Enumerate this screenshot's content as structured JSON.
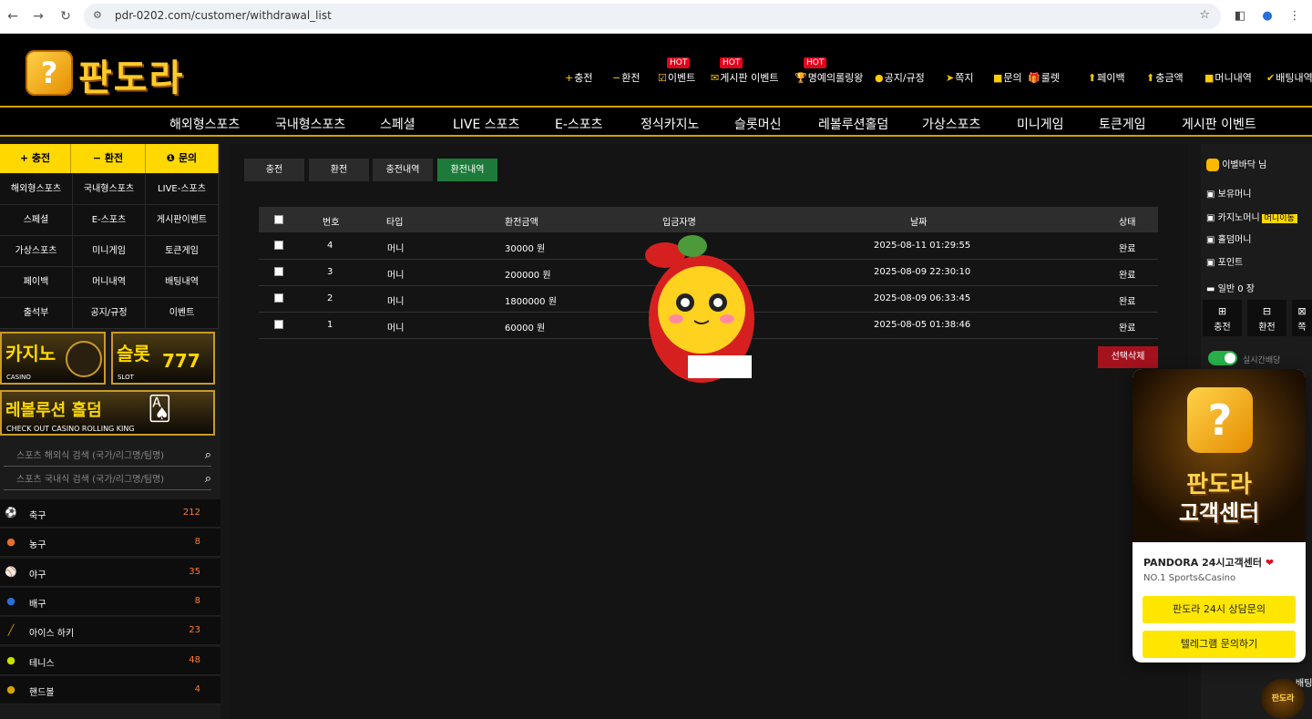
{
  "browser": {
    "url": "pdr-0202.com/customer/withdrawal_list"
  },
  "logo": {
    "text": "판도라",
    "mark": "?"
  },
  "top_links": [
    {
      "label": "충전",
      "icon": "+"
    },
    {
      "label": "환전",
      "icon": "−"
    },
    {
      "label": "이벤트",
      "icon": "☑",
      "hot": "HOT"
    },
    {
      "label": "게시판 이벤트",
      "icon": "✉",
      "hot": "HOT"
    },
    {
      "label": "명예의롤링왕",
      "icon": "🏆",
      "hot": "HOT"
    },
    {
      "label": "공지/규정",
      "icon": "●"
    },
    {
      "label": "쪽지",
      "icon": "➤"
    },
    {
      "label": "문의",
      "icon": "■"
    },
    {
      "label": "룰렛",
      "icon": "🎁"
    },
    {
      "label": "페이백",
      "icon": "⬆"
    },
    {
      "label": "충금액",
      "icon": "⬆"
    },
    {
      "label": "머니내역",
      "icon": "■"
    },
    {
      "label": "배팅내역",
      "icon": "✔"
    }
  ],
  "main_nav": [
    "해외형스포츠",
    "국내형스포츠",
    "스페셜",
    "LIVE 스포츠",
    "E-스포츠",
    "정식카지노",
    "슬롯머신",
    "레볼루션홀덤",
    "가상스포츠",
    "미니게임",
    "토큰게임",
    "게시판 이벤트"
  ],
  "sidebar": {
    "top_buttons": [
      {
        "label": "+ 충전"
      },
      {
        "label": "− 환전"
      },
      {
        "label": "❶ 문의"
      }
    ],
    "grid": [
      "해외형스포츠",
      "국내형스포츠",
      "LIVE-스포츠",
      "스페셜",
      "E-스포츠",
      "게시판이벤트",
      "가상스포츠",
      "미니게임",
      "토큰게임",
      "페이백",
      "머니내역",
      "배팅내역",
      "출석부",
      "공지/규정",
      "이벤트"
    ],
    "banners": {
      "casino_big": "카지노",
      "casino_small": "CASINO",
      "slot_big": "슬롯",
      "slot_small": "SLOT",
      "holdem_big": "레볼루션 홀덤",
      "holdem_small": "CHECK OUT CASINO ROLLING KING"
    },
    "search_overseas_placeholder": "스포츠 해외식 검색 (국가/리그명/팀명)",
    "search_domestic_placeholder": "스포츠 국내식 검색 (국가/리그명/팀명)",
    "sports": [
      {
        "name": "축구",
        "count": "212",
        "icon": "⚽",
        "color": "#ffffff"
      },
      {
        "name": "농구",
        "count": "8",
        "icon": "●",
        "color": "#e8702a"
      },
      {
        "name": "야구",
        "count": "35",
        "icon": "⚾",
        "color": "#ffffff"
      },
      {
        "name": "배구",
        "count": "8",
        "icon": "●",
        "color": "#2a6fd8"
      },
      {
        "name": "아이스 하키",
        "count": "23",
        "icon": "╱",
        "color": "#d9a200"
      },
      {
        "name": "테니스",
        "count": "48",
        "icon": "●",
        "color": "#c9e000"
      },
      {
        "name": "핸드볼",
        "count": "4",
        "icon": "●",
        "color": "#d9a200"
      }
    ]
  },
  "tabs": [
    {
      "label": "충전",
      "active": false
    },
    {
      "label": "환전",
      "active": false
    },
    {
      "label": "충전내역",
      "active": false
    },
    {
      "label": "환전내역",
      "active": true
    }
  ],
  "table": {
    "headers": [
      "번호",
      "타입",
      "환전금액",
      "입금자명",
      "날짜",
      "상태"
    ],
    "rows": [
      {
        "no": "4",
        "type": "머니",
        "amount": "30000 원",
        "name": "",
        "date": "2025-08-11 01:29:55",
        "status": "완료"
      },
      {
        "no": "3",
        "type": "머니",
        "amount": "200000 원",
        "name": "",
        "date": "2025-08-09 22:30:10",
        "status": "완료"
      },
      {
        "no": "2",
        "type": "머니",
        "amount": "1800000 원",
        "name": "",
        "date": "2025-08-09 06:33:45",
        "status": "완료"
      },
      {
        "no": "1",
        "type": "머니",
        "amount": "60000 원",
        "name": "",
        "date": "2025-08-05 01:38:46",
        "status": "완료"
      }
    ],
    "delete_label": "선택삭제"
  },
  "right_panel": {
    "username": "이별바닥 님",
    "holding_money": "보유머니",
    "casino_money": "카지노머니",
    "money_move": "머니이동",
    "holdem_money": "홀덤머니",
    "point": "포인트",
    "general": "일반 0 장",
    "btn_charge": "충전",
    "btn_exchange": "환전",
    "btn_note": "쪽",
    "realtime": "실시간배당",
    "betting": "배팅"
  },
  "popup": {
    "brand": "판도라",
    "sub": "고객센터",
    "title": "PANDORA 24시고객센터",
    "heart": "❤",
    "desc": "NO.1 Sports&Casino",
    "btn_consult": "판도라 24시 상담문의",
    "btn_telegram": "텔레그램 문의하기"
  },
  "mini_float": "판도라",
  "colors": {
    "accent": "#ffd800",
    "active_tab": "#1d7a3a",
    "delete": "#a4121e",
    "count": "#ff7b2e"
  }
}
